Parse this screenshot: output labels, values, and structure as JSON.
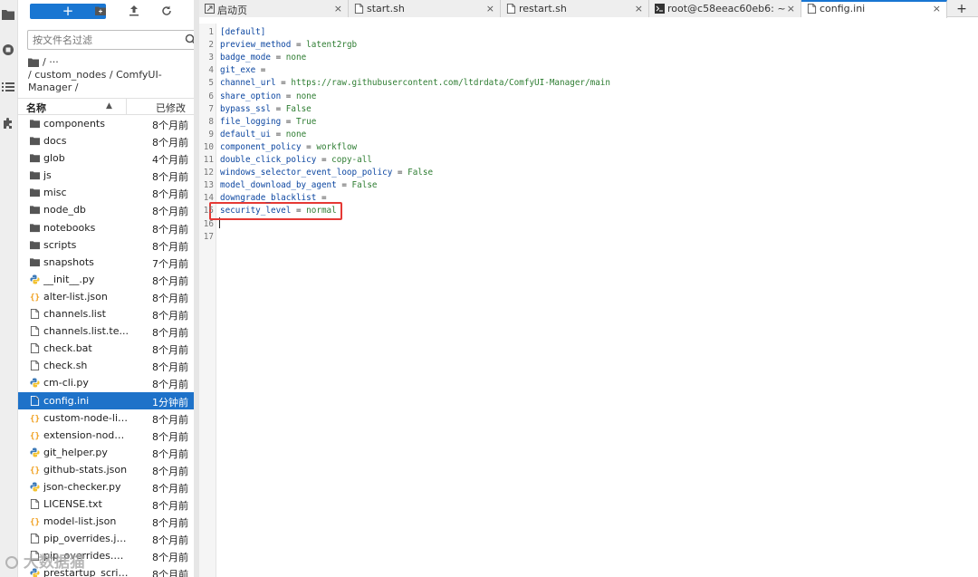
{
  "activity_bar": {
    "icons": [
      "folder-icon",
      "running-icon",
      "list-icon",
      "extension-icon"
    ]
  },
  "file_browser": {
    "new_button_label": "+",
    "filter_placeholder": "按文件名过滤",
    "breadcrumb_top": "/ ···",
    "breadcrumb_path": "/ custom_nodes / ComfyUI-Manager /",
    "header_name": "名称",
    "header_modified": "已修改",
    "files": [
      {
        "name": "components",
        "time": "8个月前",
        "type": "folder"
      },
      {
        "name": "docs",
        "time": "8个月前",
        "type": "folder"
      },
      {
        "name": "glob",
        "time": "4个月前",
        "type": "folder"
      },
      {
        "name": "js",
        "time": "8个月前",
        "type": "folder"
      },
      {
        "name": "misc",
        "time": "8个月前",
        "type": "folder"
      },
      {
        "name": "node_db",
        "time": "8个月前",
        "type": "folder"
      },
      {
        "name": "notebooks",
        "time": "8个月前",
        "type": "folder"
      },
      {
        "name": "scripts",
        "time": "8个月前",
        "type": "folder"
      },
      {
        "name": "snapshots",
        "time": "7个月前",
        "type": "folder"
      },
      {
        "name": "__init__.py",
        "time": "8个月前",
        "type": "python"
      },
      {
        "name": "alter-list.json",
        "time": "8个月前",
        "type": "json"
      },
      {
        "name": "channels.list",
        "time": "8个月前",
        "type": "file"
      },
      {
        "name": "channels.list.te...",
        "time": "8个月前",
        "type": "file"
      },
      {
        "name": "check.bat",
        "time": "8个月前",
        "type": "file"
      },
      {
        "name": "check.sh",
        "time": "8个月前",
        "type": "file"
      },
      {
        "name": "cm-cli.py",
        "time": "8个月前",
        "type": "python"
      },
      {
        "name": "config.ini",
        "time": "1分钟前",
        "type": "file",
        "selected": true
      },
      {
        "name": "custom-node-lis...",
        "time": "8个月前",
        "type": "json"
      },
      {
        "name": "extension-node...",
        "time": "8个月前",
        "type": "json"
      },
      {
        "name": "git_helper.py",
        "time": "8个月前",
        "type": "python"
      },
      {
        "name": "github-stats.json",
        "time": "8个月前",
        "type": "json"
      },
      {
        "name": "json-checker.py",
        "time": "8个月前",
        "type": "python"
      },
      {
        "name": "LICENSE.txt",
        "time": "8个月前",
        "type": "file"
      },
      {
        "name": "model-list.json",
        "time": "8个月前",
        "type": "json"
      },
      {
        "name": "pip_overrides.js...",
        "time": "8个月前",
        "type": "file"
      },
      {
        "name": "pip_overrides.os...",
        "time": "8个月前",
        "type": "file"
      },
      {
        "name": "prestartup_scrip...",
        "time": "8个月前",
        "type": "python"
      }
    ]
  },
  "tabs": [
    {
      "label": "启动页",
      "icon": "launcher-icon",
      "active": false
    },
    {
      "label": "start.sh",
      "icon": "file-icon",
      "active": false
    },
    {
      "label": "restart.sh",
      "icon": "file-icon",
      "active": false
    },
    {
      "label": "root@c58eeac60eb6: ~",
      "icon": "terminal-icon",
      "active": false
    },
    {
      "label": "config.ini",
      "icon": "file-icon",
      "active": true
    }
  ],
  "tab_close": "×",
  "tab_add": "+",
  "editor": {
    "lines": [
      {
        "num": "1",
        "section": "[default]"
      },
      {
        "num": "2",
        "key": "preview_method",
        "value": "latent2rgb"
      },
      {
        "num": "3",
        "key": "badge_mode",
        "value": "none"
      },
      {
        "num": "4",
        "key": "git_exe",
        "value": ""
      },
      {
        "num": "5",
        "key": "channel_url",
        "value": "https://raw.githubusercontent.com/ltdrdata/ComfyUI-Manager/main"
      },
      {
        "num": "6",
        "key": "share_option",
        "value": "none"
      },
      {
        "num": "7",
        "key": "bypass_ssl",
        "value": "False"
      },
      {
        "num": "8",
        "key": "file_logging",
        "value": "True"
      },
      {
        "num": "9",
        "key": "default_ui",
        "value": "none"
      },
      {
        "num": "10",
        "key": "component_policy",
        "value": "workflow"
      },
      {
        "num": "11",
        "key": "double_click_policy",
        "value": "copy-all"
      },
      {
        "num": "12",
        "key": "windows_selector_event_loop_policy",
        "value": "False"
      },
      {
        "num": "13",
        "key": "model_download_by_agent",
        "value": "False"
      },
      {
        "num": "14",
        "key": "downgrade_blacklist",
        "value": ""
      },
      {
        "num": "15",
        "key": "security_level",
        "value": "normal"
      },
      {
        "num": "16"
      },
      {
        "num": "17"
      }
    ]
  },
  "watermark": "大数据猫"
}
